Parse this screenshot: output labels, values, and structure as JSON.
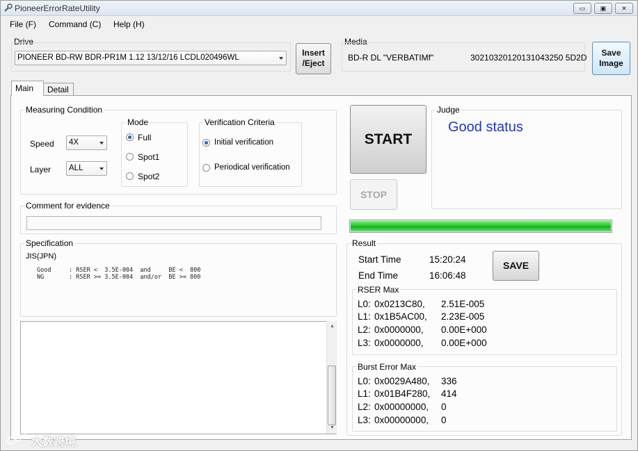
{
  "window": {
    "title": "PioneerErrorRateUtility",
    "buttons": {
      "minimize": "▭",
      "restore": "▣",
      "close": "✕"
    }
  },
  "menu": [
    "File (F)",
    "Command (C)",
    "Help (H)"
  ],
  "drive": {
    "label": "Drive",
    "selected": "PIONEER BD-RW BDR-PR1M  1.12 13/12/16  LCDL020496WL"
  },
  "insert_eject": {
    "line1": "Insert",
    "line2": "/Eject"
  },
  "media": {
    "label": "Media",
    "type": "BD-R DL \"VERBATIMf\"",
    "id": "30210320120131043250 5D2D"
  },
  "save_image": {
    "line1": "Save",
    "line2": "Image"
  },
  "tabs": [
    "Main",
    "Detail"
  ],
  "measuring": {
    "label": "Measuring Condition",
    "speed_label": "Speed",
    "speed_value": "4X",
    "layer_label": "Layer",
    "layer_value": "ALL"
  },
  "mode": {
    "label": "Mode",
    "options": [
      "Full",
      "Spot1",
      "Spot2"
    ],
    "selected": "Full"
  },
  "verification": {
    "label": "Verification Criteria",
    "options": [
      "Initial verification",
      "Periodical verification"
    ],
    "selected": "Initial verification"
  },
  "comment": {
    "label": "Comment for evidence",
    "value": ""
  },
  "specification": {
    "label": "Specification",
    "standard": "JIS(JPN)",
    "lines": [
      "Good     : RSER <  3.5E-004  and     BE <  800",
      "NG       : RSER >= 3.5E-004  and/or  BE >= 800"
    ]
  },
  "start_button": "START",
  "stop_button": "STOP",
  "judge": {
    "label": "Judge",
    "value": "Good status",
    "color": "#2233cc"
  },
  "progress": {
    "percent": 100,
    "color": "#1fc42a"
  },
  "result": {
    "label": "Result",
    "start_time_label": "Start Time",
    "start_time": "15:20:24",
    "end_time_label": "End Time",
    "end_time": "16:06:48",
    "save_button": "SAVE",
    "rser_label": "RSER Max",
    "rser": [
      {
        "layer": "L0:",
        "addr": "0x0213C80,",
        "value": "2.51E-005"
      },
      {
        "layer": "L1:",
        "addr": "0x1B5AC00,",
        "value": "2.23E-005"
      },
      {
        "layer": "L2:",
        "addr": "0x0000000,",
        "value": "0.00E+000"
      },
      {
        "layer": "L3:",
        "addr": "0x0000000,",
        "value": "0.00E+000"
      }
    ],
    "burst_label": "Burst Error Max",
    "burst": [
      {
        "layer": "L0:",
        "addr": "0x0029A480,",
        "value": "336"
      },
      {
        "layer": "L1:",
        "addr": "0x01B4F280,",
        "value": "414"
      },
      {
        "layer": "L2:",
        "addr": "0x00000000,",
        "value": "0"
      },
      {
        "layer": "L3:",
        "addr": "0x00000000,",
        "value": "0"
      }
    ]
  },
  "watermark": "大数跨境"
}
